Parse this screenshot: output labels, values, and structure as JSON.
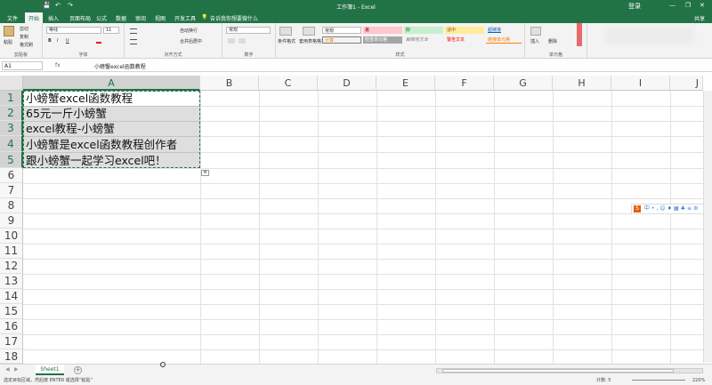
{
  "titlebar": {
    "title": "工作簿1 - Excel",
    "login": "登录",
    "minimize": "—",
    "restore": "❐",
    "close": "✕"
  },
  "quick_access": {
    "save": "💾",
    "undo": "↶",
    "redo": "↷"
  },
  "tabs": [
    "文件",
    "开始",
    "插入",
    "页面布局",
    "公式",
    "数据",
    "审阅",
    "视图",
    "开发工具"
  ],
  "tell_me": "告诉我你想要做什么",
  "share": "共享",
  "ribbon": {
    "clipboard": {
      "paste": "粘贴",
      "cut": "剪切",
      "copy": "复制",
      "format_painter": "格式刷",
      "label": "剪贴板"
    },
    "font": {
      "name": "等线",
      "size": "11",
      "bold": "B",
      "italic": "I",
      "underline": "U",
      "label": "字体"
    },
    "alignment": {
      "wrap": "自动换行",
      "merge": "合并后居中",
      "label": "对齐方式"
    },
    "number": {
      "format": "常规",
      "label": "数字"
    },
    "styles": {
      "conditional": "条件格式",
      "table": "套用表格格式",
      "cells": [
        "常规",
        "差",
        "好",
        "适中",
        "超链接",
        "计算",
        "检查单元格",
        "解释性文本",
        "警告文本",
        "链接单元格"
      ],
      "label": "样式"
    },
    "cells": {
      "insert": "插入",
      "delete": "删除",
      "label": "单元格"
    }
  },
  "formula_bar": {
    "name_box": "A1",
    "fx": "fx",
    "content": "小螃蟹excel函数教程"
  },
  "columns": [
    "A",
    "B",
    "C",
    "D",
    "E",
    "F",
    "G",
    "H",
    "I",
    "J"
  ],
  "rows": [
    "1",
    "2",
    "3",
    "4",
    "5",
    "6",
    "7",
    "8",
    "9",
    "10",
    "11",
    "12",
    "13",
    "14",
    "15",
    "16",
    "17",
    "18"
  ],
  "cells": [
    "小螃蟹excel函数教程",
    "65元一斤小螃蟹",
    "excel教程-小螃蟹",
    "小螃蟹是excel函数教程创作者",
    "跟小螃蟹一起学习excel吧！"
  ],
  "ime_toolbar": {
    "logo": "S",
    "text": "中•,☺♦▦♣≡⚙"
  },
  "sheet": {
    "tab": "Sheet1",
    "add": "+"
  },
  "status": {
    "left": "选定目标区域，然后按 ENTER 或选择“粘贴”",
    "count": "计数: 5",
    "zoom": "220%"
  },
  "colors": {
    "excel_green": "#217346",
    "bad_fill": "#ffc7ce",
    "good_fill": "#c6efce",
    "neutral_fill": "#ffeb9c",
    "calc_fill": "#f2f2f2",
    "check_fill": "#a5a5a5"
  }
}
